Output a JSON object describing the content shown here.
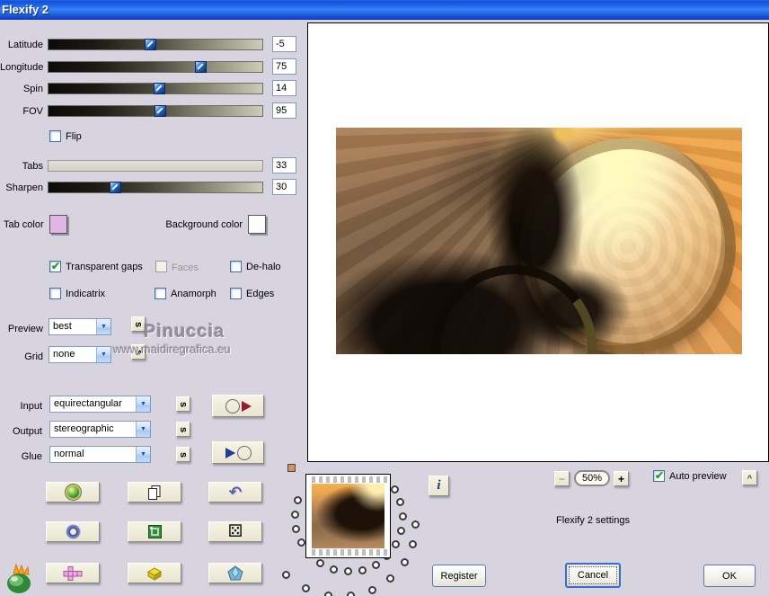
{
  "title_bar": {
    "title": "Flexify 2"
  },
  "sliders": [
    {
      "label": "Latitude",
      "value": "-5"
    },
    {
      "label": "Longitude",
      "value": "75"
    },
    {
      "label": "Spin",
      "value": "14"
    },
    {
      "label": "FOV",
      "value": "95"
    },
    {
      "label": "Tabs",
      "value": "33",
      "disabled": true
    },
    {
      "label": "Sharpen",
      "value": "30"
    }
  ],
  "flip": {
    "label": "Flip",
    "checked": false
  },
  "color_pickers": {
    "tab_label": "Tab color",
    "tab_color": "#e2b6e4",
    "background_label": "Background color",
    "background_color": "#fdfdfb"
  },
  "options": [
    {
      "label": "Transparent gaps",
      "checked": true,
      "disabled": false
    },
    {
      "label": "Faces",
      "checked": false,
      "disabled": true
    },
    {
      "label": "De-halo",
      "checked": false,
      "disabled": false
    },
    {
      "label": "Indicatrix",
      "checked": false,
      "disabled": false
    },
    {
      "label": "Anamorph",
      "checked": false,
      "disabled": false
    },
    {
      "label": "Edges",
      "checked": false,
      "disabled": false
    }
  ],
  "selects": {
    "preview": {
      "label": "Preview",
      "value": "best"
    },
    "grid": {
      "label": "Grid",
      "value": "none"
    },
    "input": {
      "label": "Input",
      "value": "equirectangular"
    },
    "output": {
      "label": "Output",
      "value": "stereographic"
    },
    "glue": {
      "label": "Glue",
      "value": "normal"
    }
  },
  "watermark": {
    "line1": "Pinuccia",
    "line2": "www.maidiregrafica.eu"
  },
  "footer": {
    "zoom_out": "−",
    "zoom_level": "50%",
    "zoom_in": "+",
    "auto_preview": {
      "label": "Auto preview",
      "checked": true
    },
    "collapse": "^",
    "settings_text": "Flexify 2 settings",
    "info": "i",
    "register": "Register",
    "cancel": "Cancel",
    "ok": "OK"
  },
  "glyphs": {
    "chevron_down": "▼",
    "s_button": "s",
    "undo": "↶",
    "dice": "⚄"
  },
  "accent": {
    "titlebar_blue": "#1e5ae8",
    "dialog_bg": "#d7d3df",
    "button_face": "#f1eedd",
    "check_green": "#21a121",
    "tab_swatch": "#e2b6e4"
  }
}
